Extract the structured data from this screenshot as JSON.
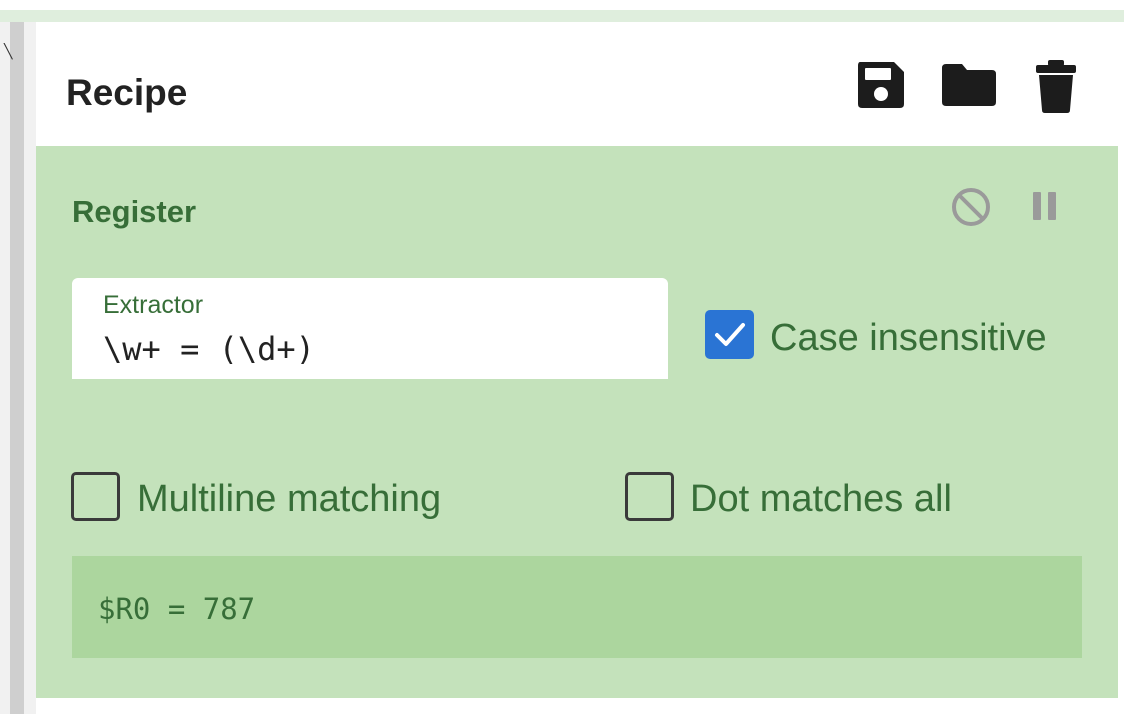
{
  "recipe": {
    "title": "Recipe",
    "actions": [
      {
        "name": "save-icon",
        "label": "Save recipe"
      },
      {
        "name": "folder-icon",
        "label": "Load recipe"
      },
      {
        "name": "trash-icon",
        "label": "Clear recipe"
      }
    ]
  },
  "operation": {
    "name": "Register",
    "controls": [
      "disable-icon",
      "pause-icon"
    ],
    "extractor": {
      "label": "Extractor",
      "value": "\\w+ = (\\d+)"
    },
    "options": [
      {
        "label": "Case insensitive",
        "checked": true
      },
      {
        "label": "Multiline matching",
        "checked": false
      },
      {
        "label": "Dot matches all",
        "checked": false
      }
    ],
    "output": "$R0 = 787"
  },
  "colors": {
    "panel": "#c4e2bb",
    "output_bg": "#acd69e",
    "accent_text": "#376e38",
    "checkbox_checked": "#2a74d4"
  }
}
